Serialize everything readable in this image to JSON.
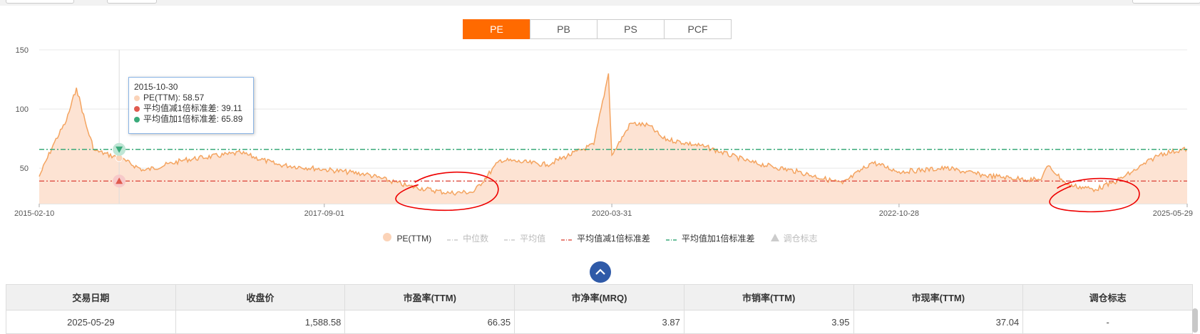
{
  "tabs": [
    {
      "label": "PE",
      "active": true
    },
    {
      "label": "PB",
      "active": false
    },
    {
      "label": "PS",
      "active": false
    },
    {
      "label": "PCF",
      "active": false
    }
  ],
  "chart_data": {
    "type": "area",
    "ylim": [
      20,
      150
    ],
    "yticks": [
      "150",
      "100",
      "50"
    ],
    "xticks": [
      "2015-02-10",
      "2017-09-01",
      "2020-03-31",
      "2022-10-28",
      "2025-05-29"
    ],
    "series": [
      {
        "name": "PE(TTM)",
        "color": "#f4a460",
        "fill": "#fde3d3",
        "x": [
          "2015-02-10",
          "2015-04-01",
          "2015-05-10",
          "2015-06-12",
          "2015-07-15",
          "2015-08-10",
          "2015-10-30",
          "2016-01-20",
          "2016-06-01",
          "2016-12-01",
          "2017-04-01",
          "2017-09-01",
          "2018-01-15",
          "2018-06-01",
          "2018-10-15",
          "2019-01-04",
          "2019-04-01",
          "2019-09-01",
          "2020-02-01",
          "2020-03-20",
          "2020-03-31",
          "2020-06-01",
          "2020-08-01",
          "2020-09-15",
          "2021-02-01",
          "2021-07-01",
          "2021-12-01",
          "2022-04-26",
          "2022-08-01",
          "2022-10-28",
          "2023-04-01",
          "2023-08-01",
          "2023-12-01",
          "2024-02-01",
          "2024-03-01",
          "2024-05-01",
          "2024-08-01",
          "2024-10-01",
          "2024-12-01",
          "2025-03-01",
          "2025-05-29"
        ],
        "y": [
          43,
          72,
          90,
          118,
          85,
          65,
          58.57,
          48,
          57,
          63,
          53,
          49,
          45,
          35,
          29,
          30,
          57,
          53,
          70,
          130,
          61,
          88,
          86,
          75,
          68,
          55,
          47,
          37,
          55,
          47,
          50,
          44,
          41,
          40,
          52,
          36,
          32,
          38,
          47,
          62,
          66.35
        ]
      }
    ],
    "lines": [
      {
        "name": "平均值减1倍标准差",
        "value": 39.11,
        "color": "#e05a4f",
        "style": "dash-dot"
      },
      {
        "name": "平均值加1倍标准差",
        "value": 65.89,
        "color": "#3aaa7a",
        "style": "dash-dot"
      }
    ],
    "legend": [
      {
        "name": "PE(TTM)",
        "active": true,
        "color": "#fbd3b8",
        "marker": "circle"
      },
      {
        "name": "中位数",
        "active": false,
        "color": "#cccccc",
        "marker": "dash-dot"
      },
      {
        "name": "平均值",
        "active": false,
        "color": "#cccccc",
        "marker": "dash-dot"
      },
      {
        "name": "平均值减1倍标准差",
        "active": true,
        "color": "#e05a4f",
        "marker": "dash-dot"
      },
      {
        "name": "平均值加1倍标准差",
        "active": true,
        "color": "#3aaa7a",
        "marker": "dash-dot"
      },
      {
        "name": "调仓标志",
        "active": false,
        "color": "#cccccc",
        "marker": "triangle"
      }
    ],
    "tooltip": {
      "date": "2015-10-30",
      "rows": [
        {
          "label": "PE(TTM): 58.57",
          "color": "#fbd3b8"
        },
        {
          "label": "平均值减1倍标准差: 39.11",
          "color": "#e05a4f"
        },
        {
          "label": "平均值加1倍标准差: 65.89",
          "color": "#3aaa7a"
        }
      ]
    },
    "annotations": "red hand-drawn circles around the 2018-2019 low and the 2024 low"
  },
  "table": {
    "headers": [
      "交易日期",
      "收盘价",
      "市盈率(TTM)",
      "市净率(MRQ)",
      "市销率(TTM)",
      "市现率(TTM)",
      "调仓标志"
    ],
    "rows": [
      [
        "2025-05-29",
        "1,588.58",
        "66.35",
        "3.87",
        "3.95",
        "37.04",
        "-"
      ]
    ]
  }
}
